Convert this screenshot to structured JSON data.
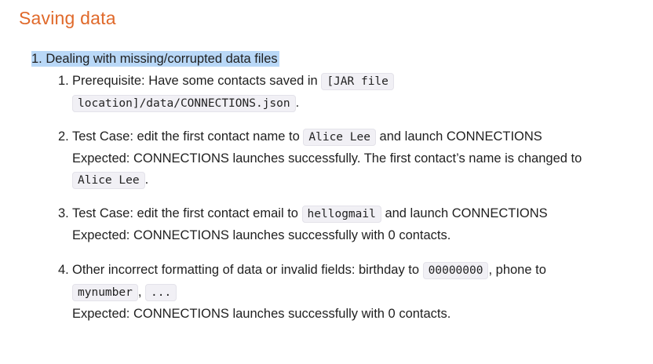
{
  "title": "Saving data",
  "section": {
    "label": "1. Dealing with missing/corrupted data files"
  },
  "items": [
    {
      "num": "1.",
      "text_a": "Prerequisite: Have some contacts saved in ",
      "code_a": "[JAR file",
      "code_b": "location]/data/CONNECTIONS.json",
      "end": "."
    },
    {
      "num": "2.",
      "text_a": "Test Case: edit the first contact name to ",
      "code_a": "Alice Lee",
      "text_b": " and launch CONNECTIONS",
      "expected": "Expected: CONNECTIONS launches successfully. The first contact’s name is changed to",
      "code_b": "Alice Lee",
      "end": "."
    },
    {
      "num": "3.",
      "text_a": "Test Case: edit the first contact email to ",
      "code_a": "hellogmail",
      "text_b": " and launch CONNECTIONS",
      "expected": "Expected: CONNECTIONS launches successfully with 0 contacts."
    },
    {
      "num": "4.",
      "text_a": "Other incorrect formatting of data or invalid fields: birthday to ",
      "code_a": "00000000",
      "text_b": ", phone to",
      "code_b": "mynumber",
      "sep": ", ",
      "code_c": "...",
      "expected": "Expected: CONNECTIONS launches successfully with 0 contacts."
    }
  ]
}
